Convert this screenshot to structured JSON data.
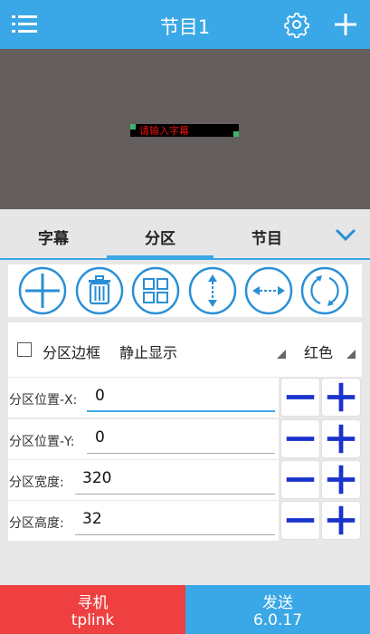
{
  "header": {
    "title": "节目1",
    "icons": [
      "menu-icon",
      "gear-icon",
      "plus-icon"
    ]
  },
  "preview": {
    "caption_text": "请输入字幕"
  },
  "tabs": [
    {
      "label": "字幕"
    },
    {
      "label": "分区",
      "selected": true
    },
    {
      "label": "节目"
    }
  ],
  "toolbar": {
    "tools": [
      "add-area-icon",
      "delete-icon",
      "grid-icon",
      "vertical-fit-icon",
      "horizontal-fit-icon",
      "rotate-icon"
    ]
  },
  "options": {
    "border_label": "分区边框",
    "border_checked": false,
    "display_mode": "静止显示",
    "color": "红色"
  },
  "fields": [
    {
      "label": "分区位置-X:",
      "value": "0"
    },
    {
      "label": "分区位置-Y:",
      "value": "0"
    },
    {
      "label": "分区宽度:",
      "value": "320"
    },
    {
      "label": "分区高度:",
      "value": "32"
    }
  ],
  "footer": {
    "left_title": "寻机",
    "left_sub": "tplink",
    "right_title": "发送",
    "right_sub": "6.0.17"
  },
  "colors": {
    "accent": "#3aa7e6",
    "danger": "#ee4040",
    "preview_bg": "#645e5e",
    "led_text": "#ee1111"
  }
}
